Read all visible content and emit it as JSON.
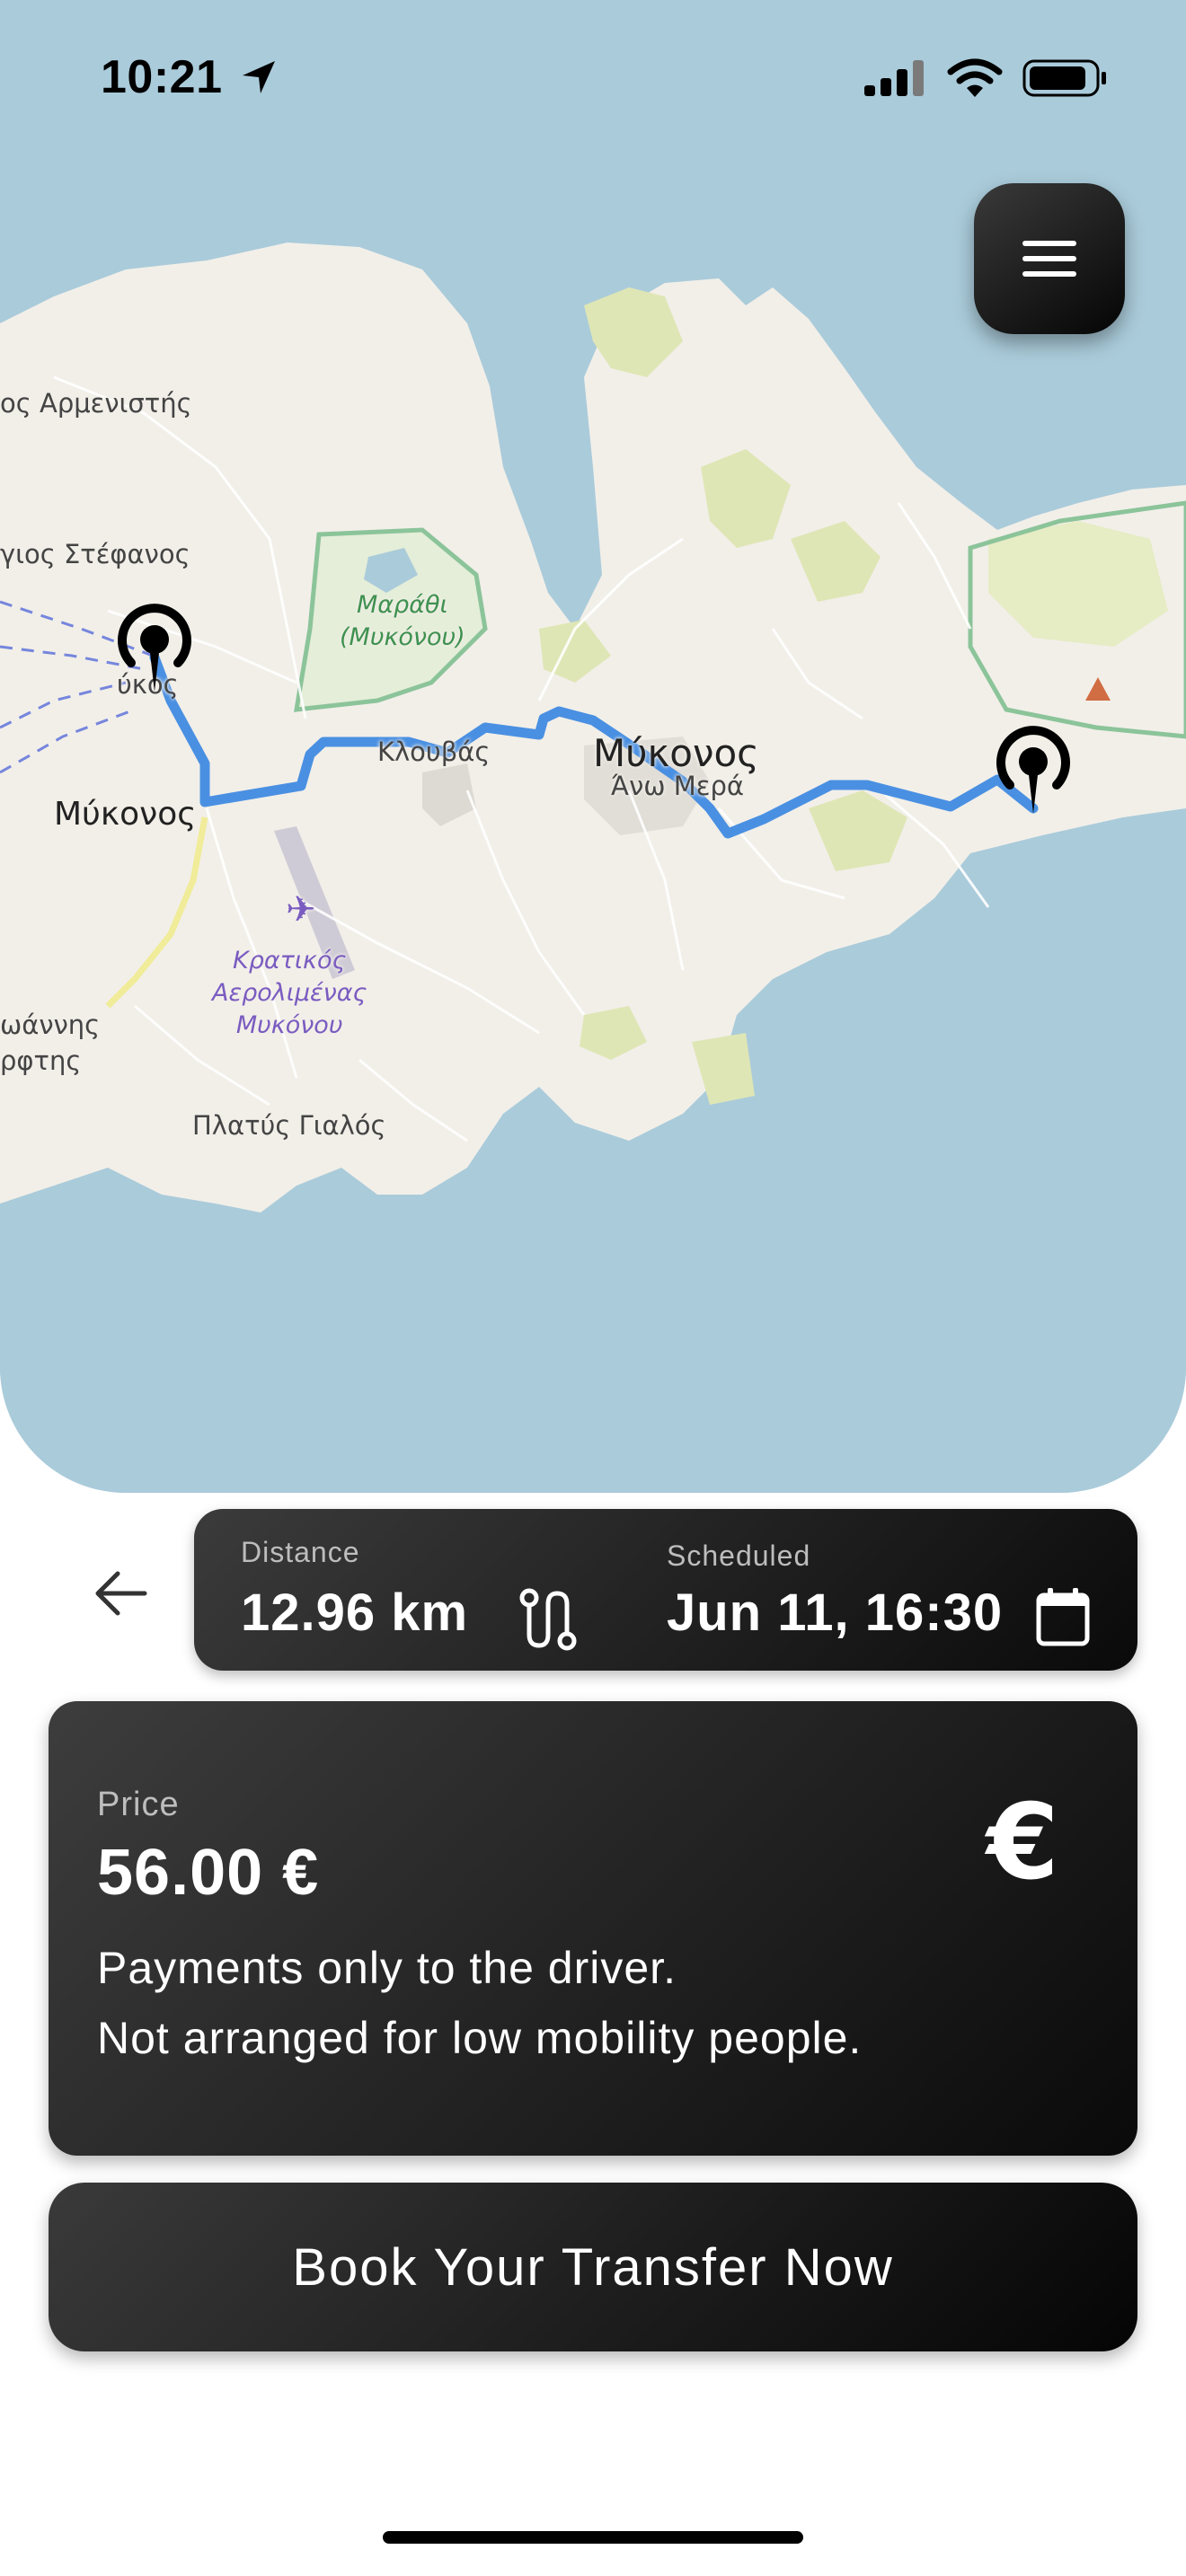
{
  "status_bar": {
    "time": "10:21"
  },
  "map": {
    "labels": {
      "armenistis": "ος Αρμενιστής",
      "agios_stefanos": "γιος Στέφανος",
      "marathi": "Μαράθι",
      "marathi_sub": "(Μυκόνου)",
      "mykonos_town_top": "ύκος",
      "mykonos_town": "Μύκονος",
      "klouvas": "Κλουβάς",
      "mykonos_center": "Μύκονος",
      "ano_mera": "Άνω Μερά",
      "airport_1": "Κρατικός",
      "airport_2": "Αερολιμένας",
      "airport_3": "Μυκόνου",
      "ioannis_1": "ωάννης",
      "ioannis_2": "ρφτης",
      "platys_gialos": "Πλατύς Γιαλός"
    }
  },
  "trip": {
    "distance_label": "Distance",
    "distance_value": "12.96 km",
    "scheduled_label": "Scheduled",
    "scheduled_value": "Jun 11, 16:30"
  },
  "price": {
    "label": "Price",
    "value": "56.00 €",
    "note_1": "Payments only to the driver.",
    "note_2": "Not arranged for low mobility people.",
    "currency_symbol": "€"
  },
  "book_button": {
    "label": "Book Your Transfer Now"
  },
  "icons": {
    "menu": "hamburger-menu-icon",
    "back": "arrow-left-icon",
    "route": "route-icon",
    "calendar": "calendar-icon",
    "location_arrow": "location-arrow-icon",
    "pin": "map-pin-icon"
  },
  "colors": {
    "route": "#4a90e2",
    "card": "#1a1a1a",
    "water": "#aacbda",
    "land": "#f2efe9"
  }
}
